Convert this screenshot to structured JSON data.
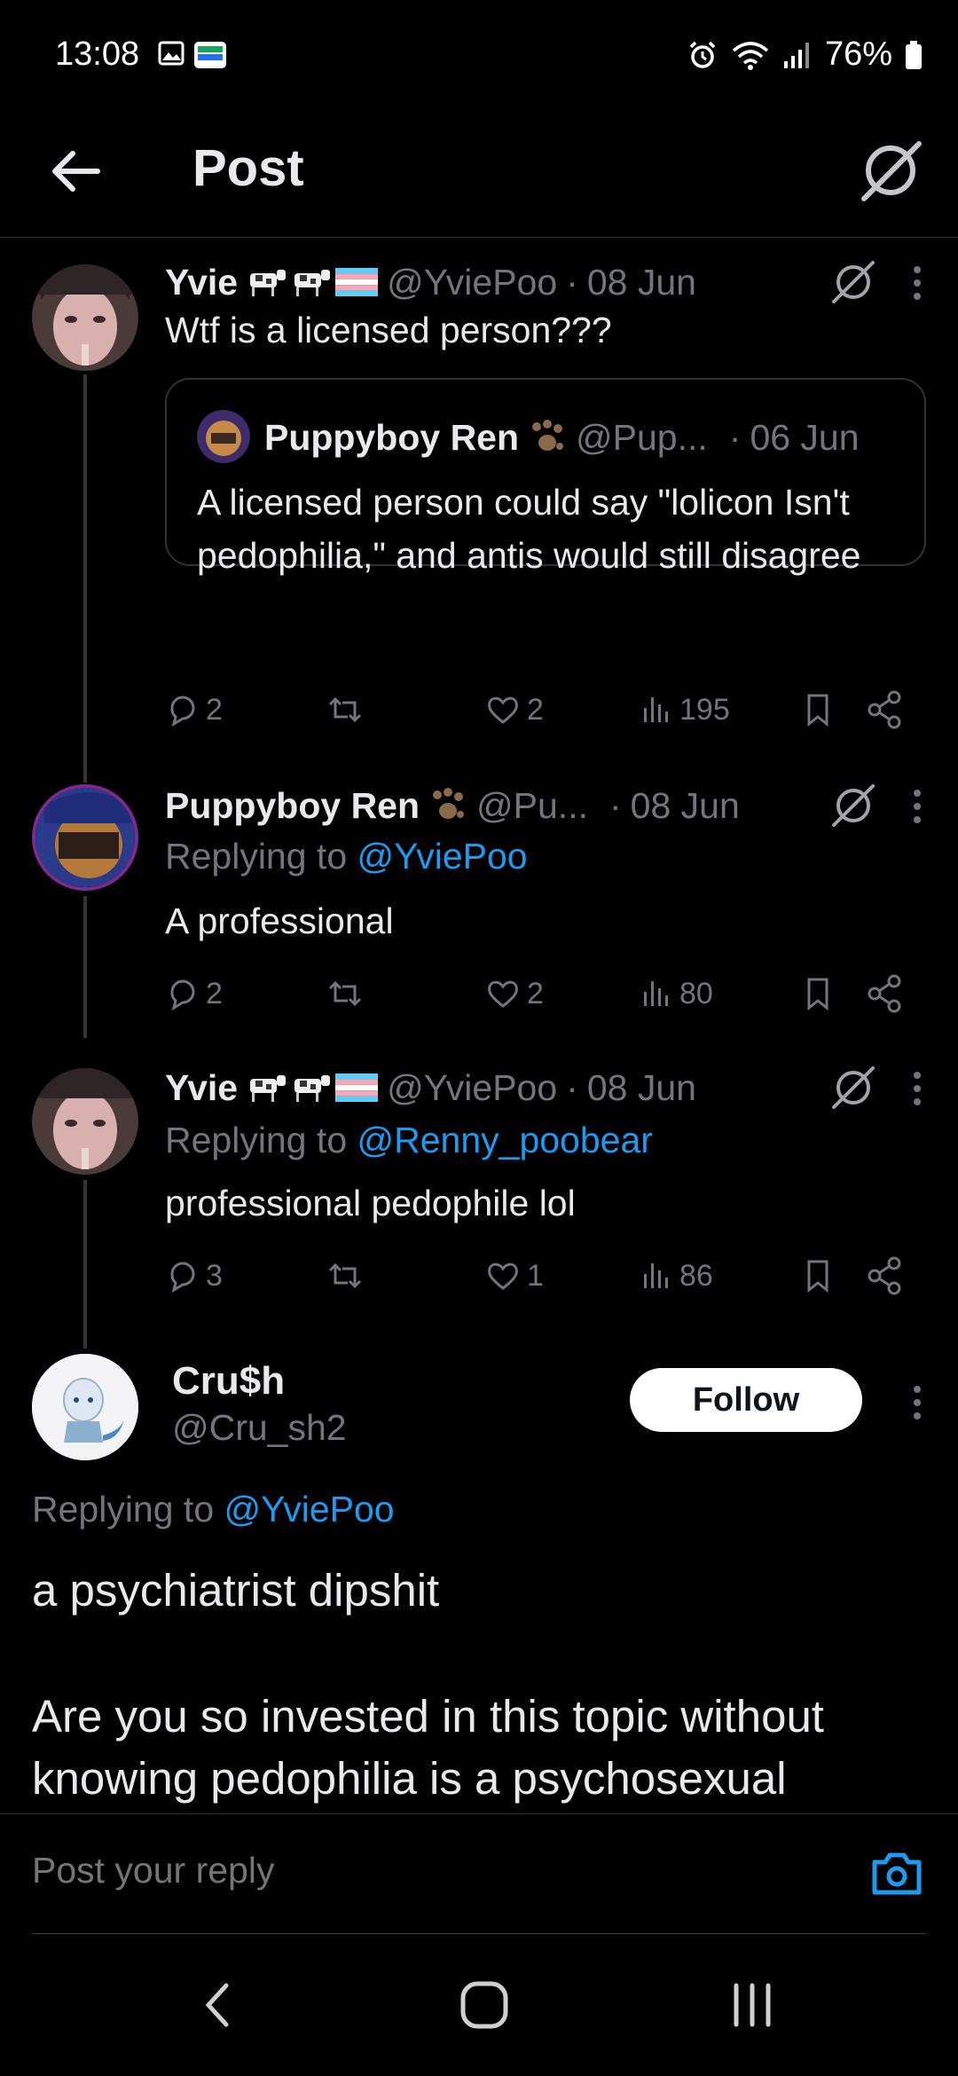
{
  "status_bar": {
    "time": "13:08",
    "battery": "76%"
  },
  "header": {
    "title": "Post"
  },
  "tweets": [
    {
      "name": "Yvie",
      "handle": "@YviePoo",
      "sep": "·",
      "date": "08 Jun",
      "text": "Wtf is a licensed person???",
      "quote": {
        "name": "Puppyboy Ren",
        "handle": "@Pup...",
        "sep": "·",
        "date": "06 Jun",
        "text": "A licensed person could say \"lolicon Isn't pedophilia,\" and antis would still disagree"
      },
      "stats": {
        "replies": "2",
        "likes": "2",
        "views": "195"
      }
    },
    {
      "name": "Puppyboy Ren",
      "handle": "@Pu...",
      "sep": "·",
      "date": "08 Jun",
      "replying_prefix": "Replying to ",
      "replying_to": "@YviePoo",
      "text": "A professional",
      "stats": {
        "replies": "2",
        "likes": "2",
        "views": "80"
      }
    },
    {
      "name": "Yvie",
      "handle": "@YviePoo",
      "sep": "·",
      "date": "08 Jun",
      "replying_prefix": "Replying to ",
      "replying_to": "@Renny_poobear",
      "text": "professional pedophile lol",
      "stats": {
        "replies": "3",
        "likes": "1",
        "views": "86"
      }
    }
  ],
  "main_post": {
    "name": "Cru$h",
    "handle": "@Cru_sh2",
    "follow_label": "Follow",
    "replying_prefix": "Replying to ",
    "replying_to": "@YviePoo",
    "text_line1": "a psychiatrist dipshit",
    "text_line2": "Are you so invested in this topic without",
    "text_line3": "knowing pedophilia is a psychosexual"
  },
  "reply_bar": {
    "placeholder": "Post your reply"
  },
  "colors": {
    "background": "#000000",
    "accent": "#1d9bf0",
    "muted": "#71767b",
    "text": "#e7e9ea",
    "border": "#2f3336"
  },
  "icons": [
    "back-arrow-icon",
    "grok-icon",
    "more-icon",
    "reply-icon",
    "repost-icon",
    "like-icon",
    "views-icon",
    "bookmark-icon",
    "share-icon",
    "camera-icon",
    "alarm-icon",
    "wifi-icon",
    "signal-icon",
    "battery-icon",
    "gallery-icon"
  ]
}
